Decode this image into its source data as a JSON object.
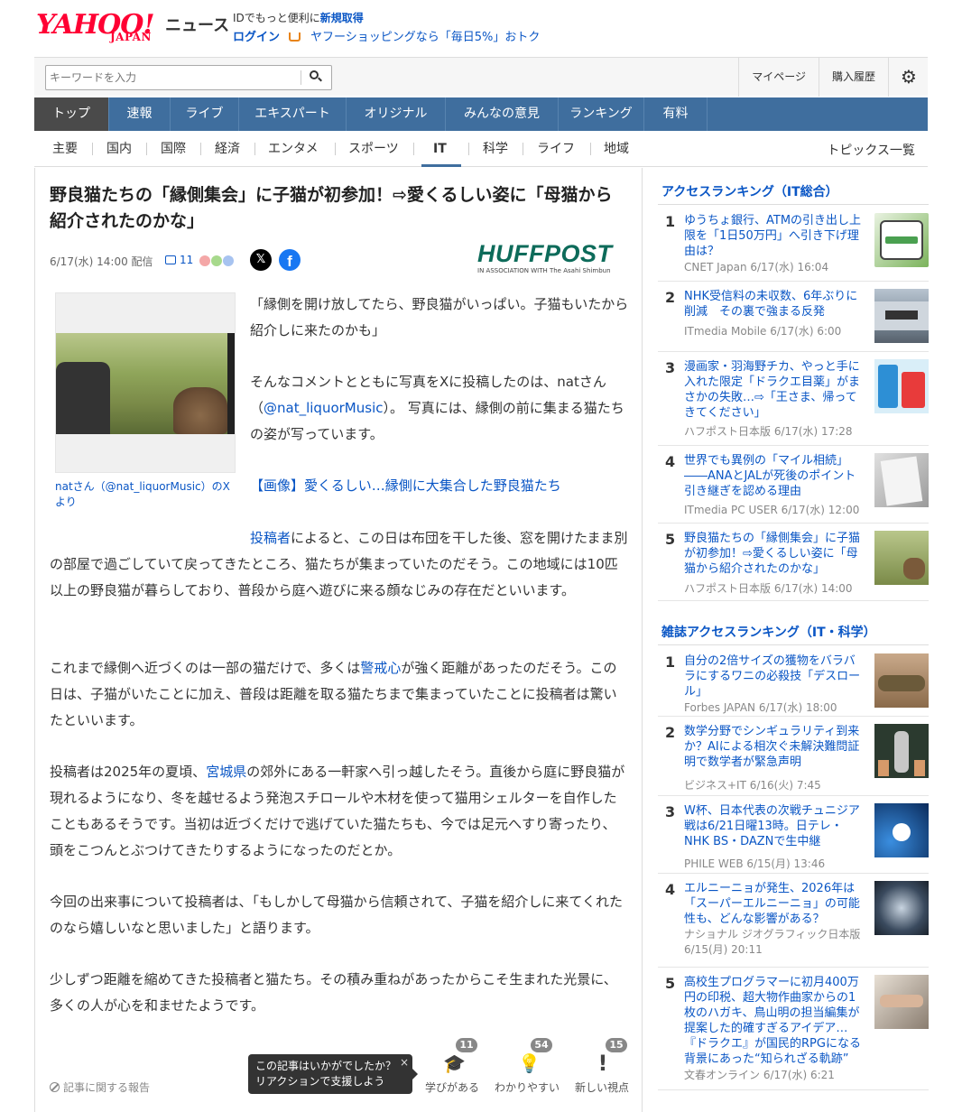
{
  "header": {
    "logo_main": "YAHOO!",
    "logo_sub": "JAPAN",
    "logo_news": "ニュース",
    "promo_prefix": "IDでもっと便利に",
    "promo_link": "新規取得",
    "login": "ログイン",
    "shopping": "ヤフーショッピングなら「毎日5%」おトク"
  },
  "search": {
    "placeholder": "キーワードを入力",
    "my_page": "マイページ",
    "purchase_history": "購入履歴"
  },
  "main_nav": [
    "トップ",
    "速報",
    "ライブ",
    "エキスパート",
    "オリジナル",
    "みんなの意見",
    "ランキング",
    "有料"
  ],
  "sub_nav": [
    "主要",
    "国内",
    "国際",
    "経済",
    "エンタメ",
    "スポーツ",
    "IT",
    "科学",
    "ライフ",
    "地域"
  ],
  "sub_nav_active": "IT",
  "topics_link": "トピックス一覧",
  "article": {
    "headline": "野良猫たちの「縁側集会」に子猫が初参加！⇨愛くるしい姿に「母猫から紹介されたのかな」",
    "date": "6/17(水) 14:00 配信",
    "comment_count": "11",
    "source_logo": "HUFFPOST",
    "source_assoc": "IN ASSOCIATION WITH The Asahi Shimbun",
    "photo_caption": "natさん（@nat_liquorMusic）のXより",
    "p1": "「縁側を開け放してたら、野良猫がいっぱい。子猫もいたから紹介しに来たのかも」",
    "p2_a": "そんなコメントとともに写真をXに投稿したのは、natさん（",
    "p2_link": "@nat_liquorMusic",
    "p2_b": "）。 写真には、縁側の前に集まる猫たちの姿が写っています。",
    "p3_link": "【画像】愛くるしい…縁側に大集合した野良猫たち",
    "p4_link": "投稿者",
    "p4": "によると、この日は布団を干した後、窓を開けたまま別の部屋で過ごしていて戻ってきたところ、猫たちが集まっていたのだそう。この地域には10匹以上の野良猫が暮らしており、普段から庭へ遊びに来る顔なじみの存在だといいます。",
    "p5_a": "これまで縁側へ近づくのは一部の猫だけで、多くは",
    "p5_link": "警戒心",
    "p5_b": "が強く距離があったのだそう。この日は、子猫がいたことに加え、普段は距離を取る猫たちまで集まっていたことに投稿者は驚いたといいます。",
    "p6_a": "投稿者は2025年の夏頃、",
    "p6_link": "宮城県",
    "p6_b": "の郊外にある一軒家へ引っ越したそう。直後から庭に野良猫が現れるようになり、冬を越せるよう発泡スチロールや木材を使って猫用シェルターを自作したこともあるそうです。当初は近づくだけで逃げていた猫たちも、今では足元へすり寄ったり、頭をこつんとぶつけてきたりするようになったのだとか。",
    "p7": "今回の出来事について投稿者は、「もしかして母猫から信頼されて、子猫を紹介しに来てくれたのなら嬉しいなと思いました」と語ります。",
    "p8": "少しずつ距離を縮めてきた投稿者と猫たち。その積み重ねがあったからこそ生まれた光景に、多くの人が心を和ませたようです。",
    "report": "記事に関する報告",
    "tooltip_line1": "この記事はいかがでしたか？",
    "tooltip_line2": "リアクションで支援しよう",
    "tooltip_close": "×",
    "reactions": [
      {
        "label": "学びがある",
        "count": "11"
      },
      {
        "label": "わかりやすい",
        "count": "54"
      },
      {
        "label": "新しい視点",
        "count": "15"
      }
    ]
  },
  "sidebar": {
    "access_title": "アクセスランキング（IT総合）",
    "access_items": [
      {
        "num": "1",
        "title": "ゆうちょ銀行、ATMの引き出し上限を「1日50万円」へ引き下げ理由は？",
        "source": "CNET Japan 6/17(水) 16:04"
      },
      {
        "num": "2",
        "title": "NHK受信料の未収数、6年ぶりに削減　その裏で強まる反発",
        "source": "ITmedia Mobile 6/17(水) 6:00"
      },
      {
        "num": "3",
        "title": "漫画家・羽海野チカ、やっと手に入れた限定「ドラクエ目薬」がまさかの失敗…⇨「王さま、帰ってきてください」",
        "source": "ハフポスト日本版 6/17(水) 17:28"
      },
      {
        "num": "4",
        "title": "世界でも異例の「マイル相続」――ANAとJALが死後のポイント引き継ぎを認める理由",
        "source": "ITmedia PC USER 6/17(水) 12:00"
      },
      {
        "num": "5",
        "title": "野良猫たちの「縁側集会」に子猫が初参加！⇨愛くるしい姿に「母猫から紹介されたのかな」",
        "source": "ハフポスト日本版 6/17(水) 14:00"
      }
    ],
    "magazine_title": "雑誌アクセスランキング（IT・科学）",
    "magazine_items": [
      {
        "num": "1",
        "title": "自分の2倍サイズの獲物をバラバラにするワニの必殺技「デスロール」",
        "source": "Forbes JAPAN 6/17(水) 18:00"
      },
      {
        "num": "2",
        "title": "数学分野でシンギュラリティ到来か？AIによる相次ぐ未解決難問証明で数学者が緊急声明",
        "source": "ビジネス+IT 6/16(火) 7:45"
      },
      {
        "num": "3",
        "title": "W杯、日本代表の次戦チュニジア戦は6/21日曜13時。日テレ・NHK BS・DAZNで生中継",
        "source": "PHILE WEB 6/15(月) 13:46"
      },
      {
        "num": "4",
        "title": "エルニーニョが発生、2026年は「スーパーエルニーニョ」の可能性も、どんな影響がある？",
        "source": "ナショナル ジオグラフィック日本版 6/15(月) 20:11"
      },
      {
        "num": "5",
        "title": "高校生プログラマーに初月400万円の印税、超大物作曲家からの1枚のハガキ、鳥山明の担当編集が提案した的確すぎるアイデア…『ドラクエ』が国民的RPGになる背景にあった“知られざる軌跡”",
        "source": "文春オンライン 6/17(水) 6:21"
      }
    ]
  }
}
